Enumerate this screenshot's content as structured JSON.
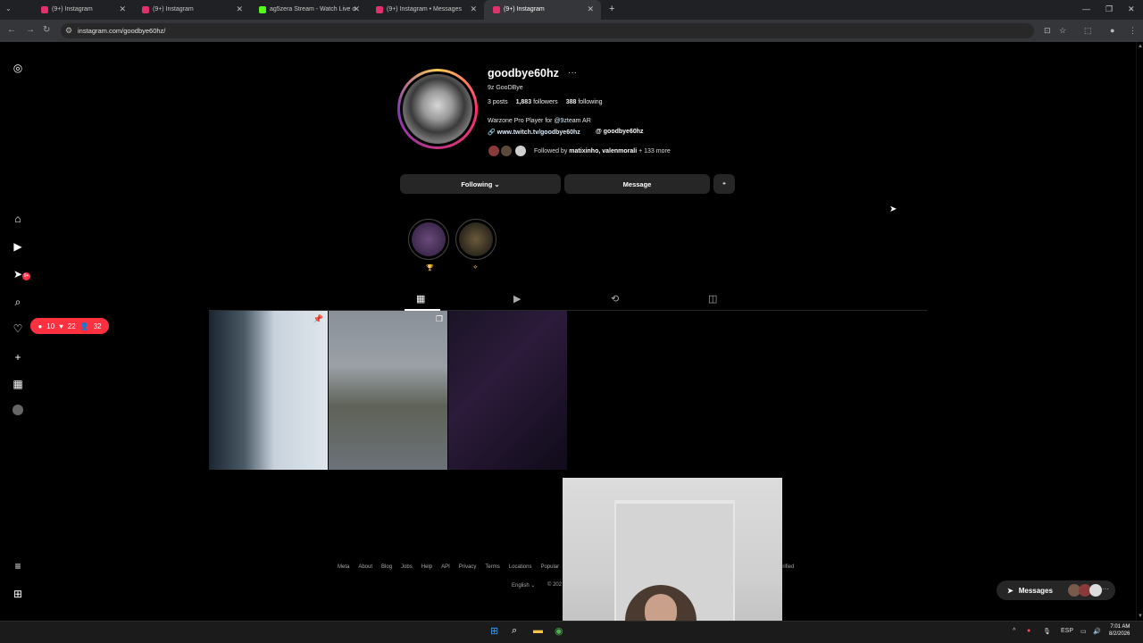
{
  "browser": {
    "tabs": [
      {
        "title": "(9+) Instagram",
        "icon": "instagram-icon",
        "color": "#e1306c"
      },
      {
        "title": "(9+) Instagram",
        "icon": "instagram-icon",
        "color": "#e1306c"
      },
      {
        "title": "ag5zera Stream - Watch Live o",
        "icon": "kick-icon",
        "color": "#53fc18"
      },
      {
        "title": "(9+) Instagram • Messages",
        "icon": "instagram-icon",
        "color": "#e1306c"
      },
      {
        "title": "(9+) Instagram",
        "icon": "instagram-icon",
        "color": "#e1306c",
        "active": true
      }
    ],
    "url": "instagram.com/goodbye60hz/"
  },
  "profile": {
    "username": "goodbye60hz",
    "display_name": "9z GooDBye",
    "posts": "3 posts",
    "followers_count": "1,883",
    "followers_label": "followers",
    "following_count": "388",
    "following_label": "following",
    "bio_prefix": "Warzone Pro Player for ",
    "bio_tag": "@9zteam",
    "bio_suffix": " AR",
    "link": "www.twitch.tv/goodbye60hz",
    "threads": "goodbye60hz",
    "followed_by_prefix": "Followed by ",
    "followed_by_names": "matixinho, valenmorali",
    "followed_by_more": " + 133 more",
    "following_button": "Following",
    "message_button": "Message"
  },
  "notifications": {
    "comments": "10",
    "likes": "22",
    "follows": "32",
    "badge": "9+"
  },
  "footer": {
    "links": [
      "Meta",
      "About",
      "Blog",
      "Jobs",
      "Help",
      "API",
      "Privacy",
      "Terms",
      "Locations",
      "Popular"
    ],
    "language": "English",
    "copyright": "© 202",
    "verified": "erified"
  },
  "messages": {
    "label": "Messages",
    "badge": "9+"
  },
  "taskbar": {
    "lang": "ESP",
    "time": "7:01 AM",
    "date": "8/2/2026"
  }
}
